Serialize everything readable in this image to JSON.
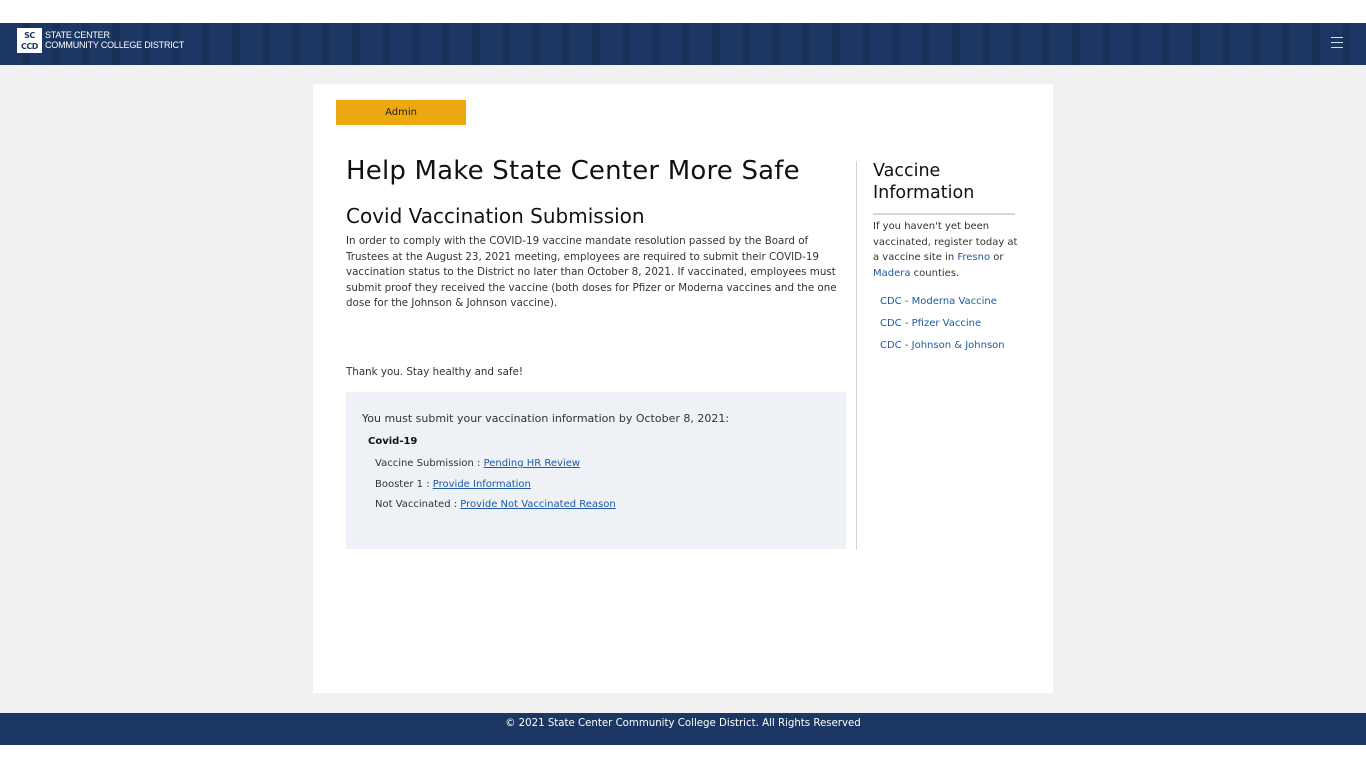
{
  "header": {
    "logo_mark_top": "SC",
    "logo_mark_bottom": "CCD",
    "logo_line1": "State Center",
    "logo_line2": "Community College District",
    "menu_icon": "hamburger-icon"
  },
  "admin_button": "Admin",
  "main": {
    "title": "Help Make State Center More Safe",
    "subtitle": "Covid Vaccination Submission",
    "intro": "In order to comply with the COVID-19 vaccine mandate resolution passed by the Board of Trustees at the August 23, 2021 meeting, employees are required to submit their COVID-19 vaccination status to the District no later than October 8, 2021. If vaccinated, employees must submit proof they received the vaccine (both doses for Pfizer or Moderna vaccines and the one dose for the Johnson & Johnson vaccine).",
    "thanks": "Thank you. Stay healthy and safe!"
  },
  "status": {
    "heading": "You must submit your vaccination information by October 8, 2021:",
    "group": "Covid-19",
    "rows": [
      {
        "label": "Vaccine Submission : ",
        "link": "Pending HR Review"
      },
      {
        "label": "Booster 1 : ",
        "link": "Provide Information"
      },
      {
        "label": "Not Vaccinated : ",
        "link": "Provide Not Vaccinated Reason"
      }
    ]
  },
  "sidebar": {
    "title_line1": "Vaccine",
    "title_line2": "Information",
    "text_before": "If you haven't yet been vaccinated, register today at a vaccine site in ",
    "link_fresno": "Fresno",
    "text_or": " or ",
    "link_madera": "Madera",
    "text_after": " counties.",
    "links": [
      "CDC - Moderna Vaccine",
      "CDC - Pfizer Vaccine",
      "CDC - Johnson & Johnson"
    ]
  },
  "footer": {
    "text": "© 2021 State Center Community College District. All Rights Reserved"
  },
  "colors": {
    "brand_navy": "#1c3764",
    "admin_gold": "#eea80f",
    "link_blue": "#1f5aa6",
    "status_box_bg": "#eef1f5"
  }
}
